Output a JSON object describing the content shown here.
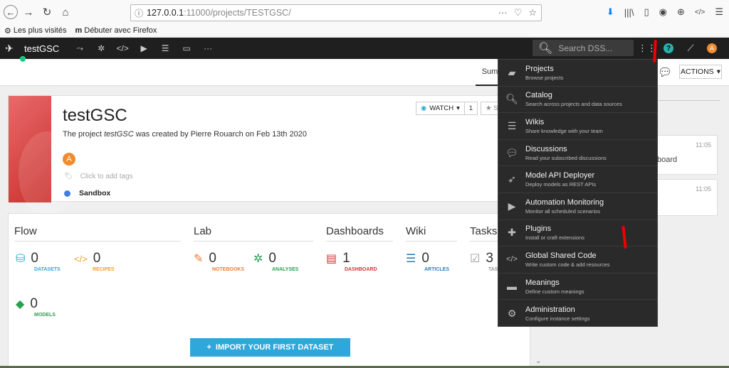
{
  "browser": {
    "url_host": "127.0.0.1",
    "url_port_path": ":11000/projects/TESTGSC/",
    "bookmarks": [
      "Les plus visités",
      "Débuter avec Firefox"
    ]
  },
  "topnav": {
    "project_name": "testGSC",
    "search_placeholder": "Search DSS..."
  },
  "subbar": {
    "summary_tab": "Sum",
    "actions_label": "ACTIONS"
  },
  "project": {
    "title": "testGSC",
    "desc_prefix": "The project ",
    "desc_name": "testGSC",
    "desc_suffix": " was created by Pierre Rouarch on Feb 13th 2020",
    "avatar_letter": "A",
    "tags_placeholder": "Click to add tags",
    "status": "Sandbox",
    "watch_label": "WATCH",
    "watch_count": "1",
    "star_label": "S"
  },
  "sections": {
    "flow": {
      "title": "Flow",
      "datasets": {
        "count": "0",
        "label": "DATASETS"
      },
      "recipes": {
        "count": "0",
        "label": "RECIPES"
      },
      "models": {
        "count": "0",
        "label": "MODELS"
      }
    },
    "lab": {
      "title": "Lab",
      "notebooks": {
        "count": "0",
        "label": "NOTEBOOKS"
      },
      "analyses": {
        "count": "0",
        "label": "ANALYSES"
      }
    },
    "dashboards": {
      "title": "Dashboards",
      "dashboard": {
        "count": "1",
        "label": "DASHBOARD"
      }
    },
    "wiki": {
      "title": "Wiki",
      "articles": {
        "count": "0",
        "label": "ARTICLES"
      }
    },
    "tasks": {
      "title": "Tasks",
      "tasks": {
        "count": "3",
        "label": "TAS"
      }
    }
  },
  "import_button": "IMPORT YOUR FIRST DATASET",
  "activity": [
    {
      "time": "11:05",
      "text": "board"
    },
    {
      "time": "11:05",
      "text": ""
    }
  ],
  "menu": [
    {
      "title": "Projects",
      "desc": "Browse projects",
      "icon": "folder-icon"
    },
    {
      "title": "Catalog",
      "desc": "Search across projects and data sources",
      "icon": "search-icon"
    },
    {
      "title": "Wikis",
      "desc": "Share knowledge with your team",
      "icon": "wiki-icon"
    },
    {
      "title": "Discussions",
      "desc": "Read your subscribed discussions",
      "icon": "comments-icon"
    },
    {
      "title": "Model API Deployer",
      "desc": "Deploy models as REST APIs",
      "icon": "rocket-icon"
    },
    {
      "title": "Automation Monitoring",
      "desc": "Monitor all scheduled scenarios",
      "icon": "play-icon"
    },
    {
      "title": "Plugins",
      "desc": "Install or craft extensions",
      "icon": "puzzle-icon"
    },
    {
      "title": "Global Shared Code",
      "desc": "Write custom code & add resources",
      "icon": "code-icon"
    },
    {
      "title": "Meanings",
      "desc": "Define custom meanings",
      "icon": "tag-icon"
    },
    {
      "title": "Administration",
      "desc": "Configure instance settings",
      "icon": "gear-icon"
    }
  ],
  "colors": {
    "nav_bg": "#1f1f1f",
    "menu_bg": "#2a2a2a",
    "accent_blue": "#2ea7db",
    "accent_orange": "#f08c2f",
    "project_banner": "#c9302c"
  }
}
